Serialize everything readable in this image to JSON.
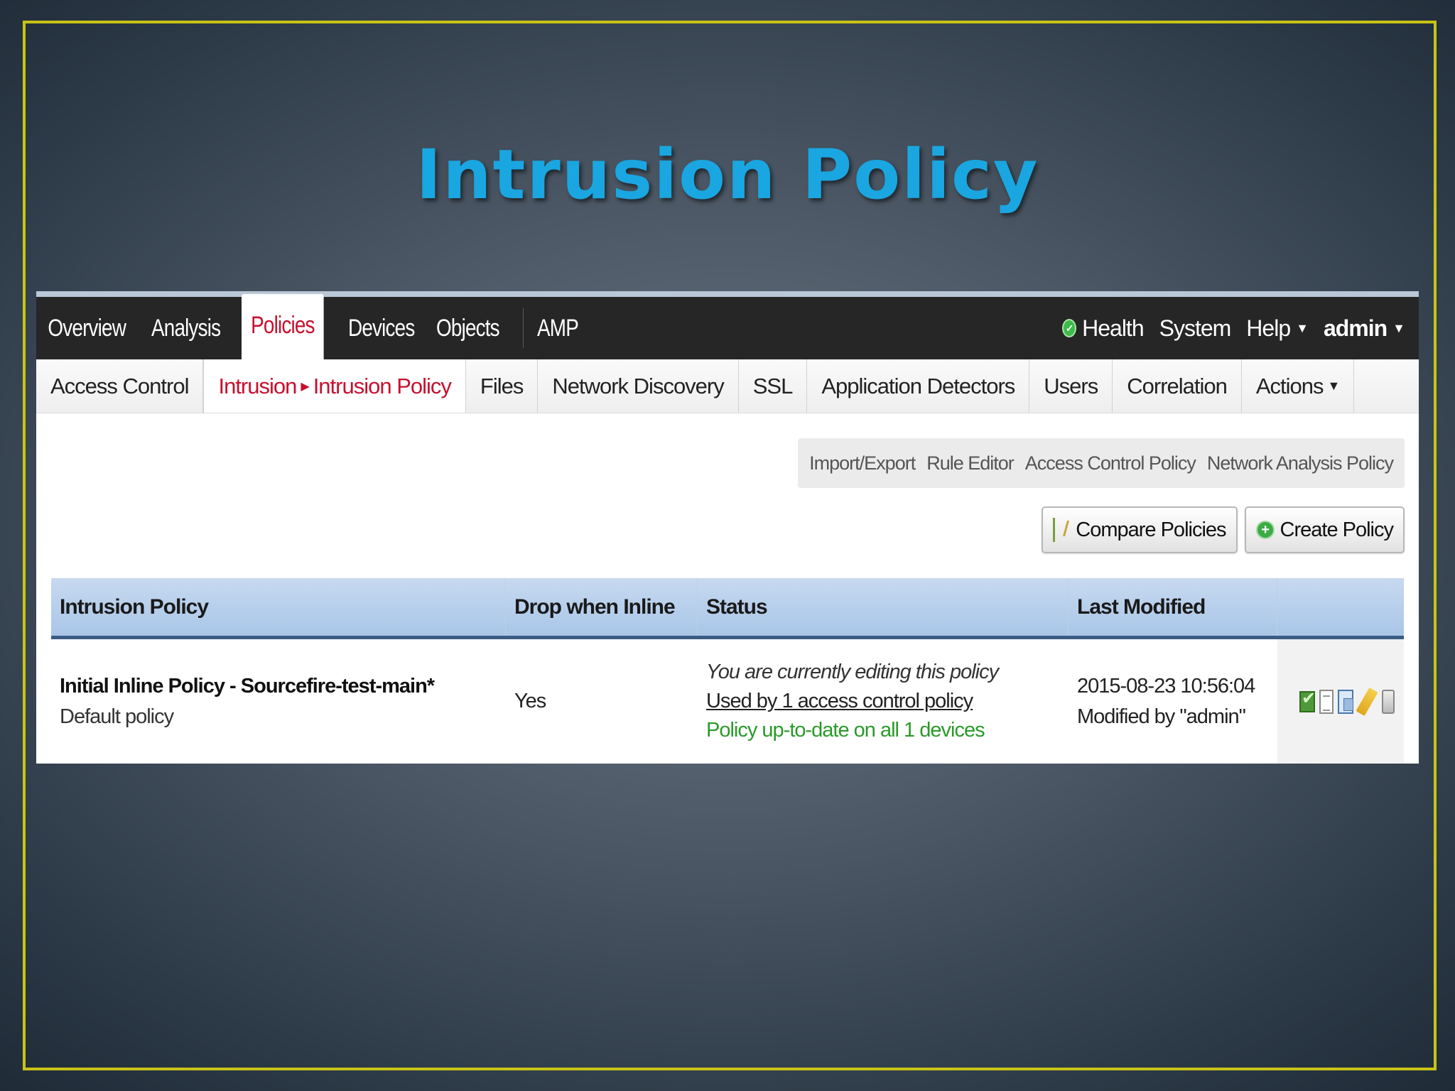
{
  "slide": {
    "title": "Intrusion Policy"
  },
  "topnav": {
    "items": [
      "Overview",
      "Analysis",
      "Policies",
      "Devices",
      "Objects",
      "AMP"
    ],
    "active": "Policies",
    "right": {
      "health": "Health",
      "system": "System",
      "help": "Help",
      "user": "admin"
    }
  },
  "subnav": {
    "items": [
      "Access Control",
      "Intrusion",
      "Intrusion Policy",
      "Files",
      "Network Discovery",
      "SSL",
      "Application Detectors",
      "Users",
      "Correlation",
      "Actions"
    ],
    "active": "Intrusion ▸ Intrusion Policy"
  },
  "toolbar_links": [
    "Import/Export",
    "Rule Editor",
    "Access Control Policy",
    "Network Analysis Policy"
  ],
  "buttons": {
    "compare": "Compare Policies",
    "create": "Create Policy"
  },
  "table": {
    "headers": [
      "Intrusion Policy",
      "Drop when Inline",
      "Status",
      "Last Modified",
      ""
    ],
    "rows": [
      {
        "name": "Initial Inline Policy - Sourcefire-test-main*",
        "description": "Default policy",
        "drop_when_inline": "Yes",
        "status_editing": "You are currently editing this policy",
        "status_used_by": "Used by 1 access control policy",
        "status_uptodate": "Policy up-to-date on all 1 devices",
        "modified_date": "2015-08-23 10:56:04",
        "modified_by": "Modified by \"admin\"",
        "action_icons": [
          "check-icon",
          "report-icon",
          "copy-icon",
          "edit-icon",
          "delete-icon"
        ]
      }
    ]
  },
  "colors": {
    "accent_red": "#c8102e",
    "title_blue": "#1aa6e0",
    "frame_yellow": "#c9c316",
    "header_blue": "#a9c6e8",
    "status_green": "#2a9a2a"
  }
}
